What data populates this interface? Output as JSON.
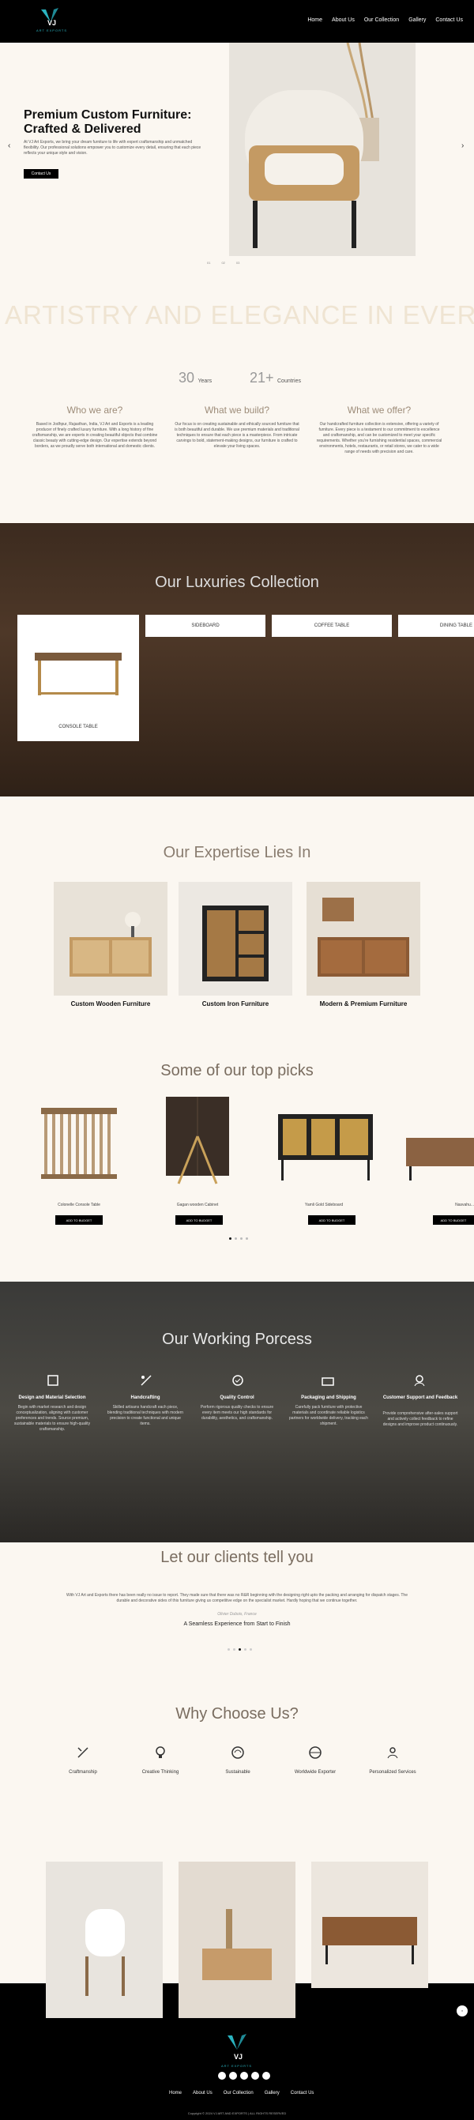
{
  "header": {
    "brand": "VJ",
    "brand_sub": "ART EXPORTS",
    "nav": [
      "Home",
      "About Us",
      "Our Collection",
      "Gallery",
      "Contact Us"
    ]
  },
  "hero": {
    "title": "Premium Custom Furniture: Crafted & Delivered",
    "description": "At VJ Art Exports, we bring your dream furniture to life with expert craftsmanship and unmatched flexibility. Our professional solutions empower you to customize every detail, ensuring that each piece reflects your unique style and vision.",
    "cta": "Contact Us",
    "prev": "‹",
    "next": "›",
    "slide_labels": [
      "01",
      "02",
      "03"
    ]
  },
  "marquee": "ARTISTRY AND ELEGANCE IN EVERY",
  "stats": [
    {
      "num": "30",
      "label": "Years"
    },
    {
      "num": "21+",
      "label": "Countries"
    }
  ],
  "about": [
    {
      "title": "Who we are?",
      "text": "Based in Jodhpur, Rajasthan, India, VJ Art and Exports is a leading producer of finely crafted luxury furniture. With a long history of fine craftsmanship, we are experts in creating beautiful objects that combine classic beauty with cutting-edge design. Our expertise extends beyond borders, as we proudly serve both international and domestic clients."
    },
    {
      "title": "What we build?",
      "text": "Our focus is on creating sustainable and ethically sourced furniture that is both beautiful and durable. We use premium materials and traditional techniques to ensure that each piece is a masterpiece. From intricate carvings to bold, statement-making designs, our furniture is crafted to elevate your living spaces."
    },
    {
      "title": "What we offer?",
      "text": "Our handcrafted furniture collection is extensive, offering a variety of furniture. Every piece is a testament to our commitment to excellence and craftsmanship, and can be customized to meet your specific requirements. Whether you're furnishing residential spaces, commercial environments, hotels, restaurants, or retail stores, we cater to a wide range of needs with precision and care."
    }
  ],
  "collection": {
    "title": "Our Luxuries Collection",
    "items": [
      "CONSOLE TABLE",
      "SIDEBOARD",
      "COFFEE TABLE",
      "DINING TABLE"
    ]
  },
  "expertise": {
    "title": "Our Expertise Lies In",
    "items": [
      "Custom Wooden Furniture",
      "Custom Iron Furniture",
      "Modern & Premium Furniture"
    ]
  },
  "picks": {
    "title": "Some of our top picks",
    "items": [
      "Colonelle Console Table",
      "Gagan wooden Cabinet",
      "Yamli Gold Sideboard",
      "Nasvahu..."
    ],
    "button": "ADD TO BUDGET"
  },
  "process": {
    "title": "Our Working Porcess",
    "steps": [
      {
        "title": "Design and Material Selection",
        "text": "Begin with market research and design conceptualization, aligning with customer preferences and trends. Source premium, sustainable materials to ensure high-quality craftsmanship."
      },
      {
        "title": "Handcrafting",
        "text": "Skilled artisans handcraft each piece, blending traditional techniques with modern precision to create functional and unique items."
      },
      {
        "title": "Quality Control",
        "text": "Perform rigorous quality checks to ensure every item meets our high standards for durability, aesthetics, and craftsmanship."
      },
      {
        "title": "Packaging and Shipping",
        "text": "Carefully pack furniture with protective materials and coordinate reliable logistics partners for worldwide delivery, tracking each shipment."
      },
      {
        "title": "Customer Support and Feedback",
        "text": "Provide comprehensive after-sales support and actively collect feedback to refine designs and improve product continuously."
      }
    ]
  },
  "testimonials": {
    "title": "Let our clients tell you",
    "quote": "With VJ Art and Exports there has been really no issue to report. They made sure that there was no R&R beginning with the designing right upto the packing and arranging for dispatch stages. The durable and decorative sides of this furniture giving us competitive edge on the specialist market. Hardly hoping that we continue together.",
    "author": "Olivier Dubois, France",
    "headline": "A Seamless Experience from Start to Finish"
  },
  "why": {
    "title": "Why Choose Us?",
    "items": [
      "Craftmanship",
      "Creative Thinking",
      "Sustainable",
      "Worldwide Exporter",
      "Personalized Services"
    ]
  },
  "footer": {
    "brand": "VJ",
    "brand_sub": "ART EXPORTS",
    "nav": [
      "Home",
      "About Us",
      "Our Collection",
      "Gallery",
      "Contact Us"
    ],
    "copyright": "Copyright © 2024 VJ ART AND EXPORTS | ALL RIGHTS RESERVED"
  },
  "colors": {
    "accent": "#9d8c79",
    "dark": "#000000",
    "cream": "#fbf7f1"
  }
}
